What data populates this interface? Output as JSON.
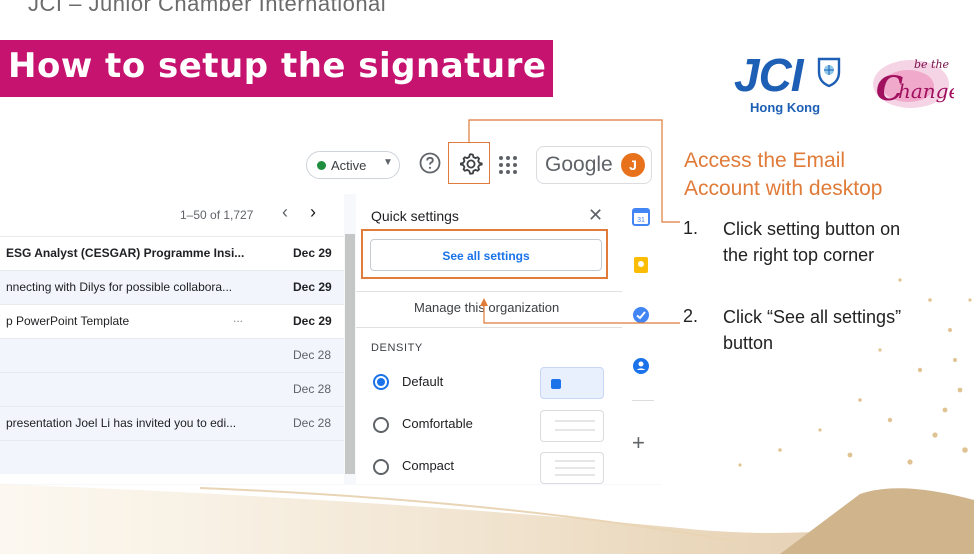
{
  "slide": {
    "top_header": "JCI – Junior Chamber International",
    "title": "How to setup the signature (I)"
  },
  "logos": {
    "jci_text": "JCI",
    "jci_sub": "Hong Kong",
    "change_text": "be the Change"
  },
  "gmail": {
    "status": "Active",
    "brand": "Google",
    "avatar_initial": "J",
    "pagination": "1–50 of 1,727",
    "emails": [
      {
        "subject": "ESG Analyst (CESGAR) Programme Insi...",
        "date": "Dec 29",
        "unread": true
      },
      {
        "subject": "nnecting with Dilys for possible collabora...",
        "date": "Dec 29",
        "unread": false
      },
      {
        "subject": "p PowerPoint Template",
        "date": "Dec 29",
        "unread": false,
        "extra": "..."
      },
      {
        "subject": "",
        "date": "Dec 28",
        "unread": false
      },
      {
        "subject": "",
        "date": "Dec 28",
        "unread": false
      },
      {
        "subject": "presentation Joel Li has invited you to edi...",
        "date": "Dec 28",
        "unread": false
      }
    ],
    "quick_settings": {
      "title": "Quick settings",
      "see_all": "See all settings",
      "manage_org": "Manage this organization",
      "density_label": "DENSITY",
      "options": [
        "Default",
        "Comfortable",
        "Compact"
      ],
      "selected": "Default"
    }
  },
  "instructions": {
    "heading_line1": "Access the Email",
    "heading_line2": "Account with desktop",
    "step1_num": "1.",
    "step1_line1": "Click setting button on",
    "step1_line2": "the right top corner",
    "step2_num": "2.",
    "step2_line1": "Click “See all settings”",
    "step2_line2": "button"
  },
  "colors": {
    "banner": "#c5136f",
    "callout": "#e07b39",
    "gmail_blue": "#1a73e8",
    "jci_blue": "#1d5fb5"
  }
}
